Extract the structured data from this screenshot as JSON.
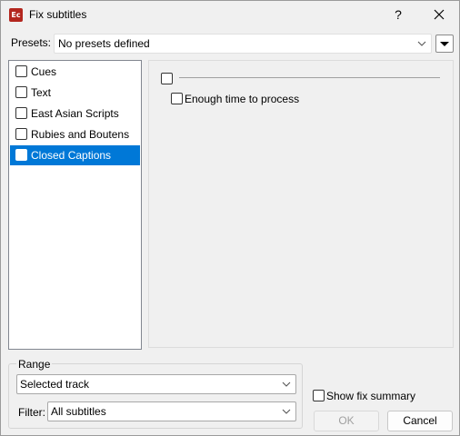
{
  "window": {
    "app_icon_text": "Ec",
    "title": "Fix subtitles",
    "help_label": "?"
  },
  "presets": {
    "label": "Presets:",
    "value": "No presets defined"
  },
  "categories": [
    {
      "label": "Cues",
      "checked": false
    },
    {
      "label": "Text",
      "checked": false
    },
    {
      "label": "East Asian Scripts",
      "checked": false
    },
    {
      "label": "Rubies and Boutens",
      "checked": false
    },
    {
      "label": "Closed Captions",
      "checked": false,
      "selected": true
    }
  ],
  "options": {
    "group_checked": false,
    "enough_time_label": "Enough time to process",
    "enough_time_checked": false
  },
  "range": {
    "label": "Range",
    "track_value": "Selected track",
    "filter_label": "Filter:",
    "filter_value": "All subtitles"
  },
  "footer": {
    "show_fix_summary_label": "Show fix summary",
    "show_fix_summary_checked": false,
    "ok_label": "OK",
    "cancel_label": "Cancel"
  },
  "colors": {
    "selection": "#0078d7",
    "app_icon": "#b3261e"
  }
}
